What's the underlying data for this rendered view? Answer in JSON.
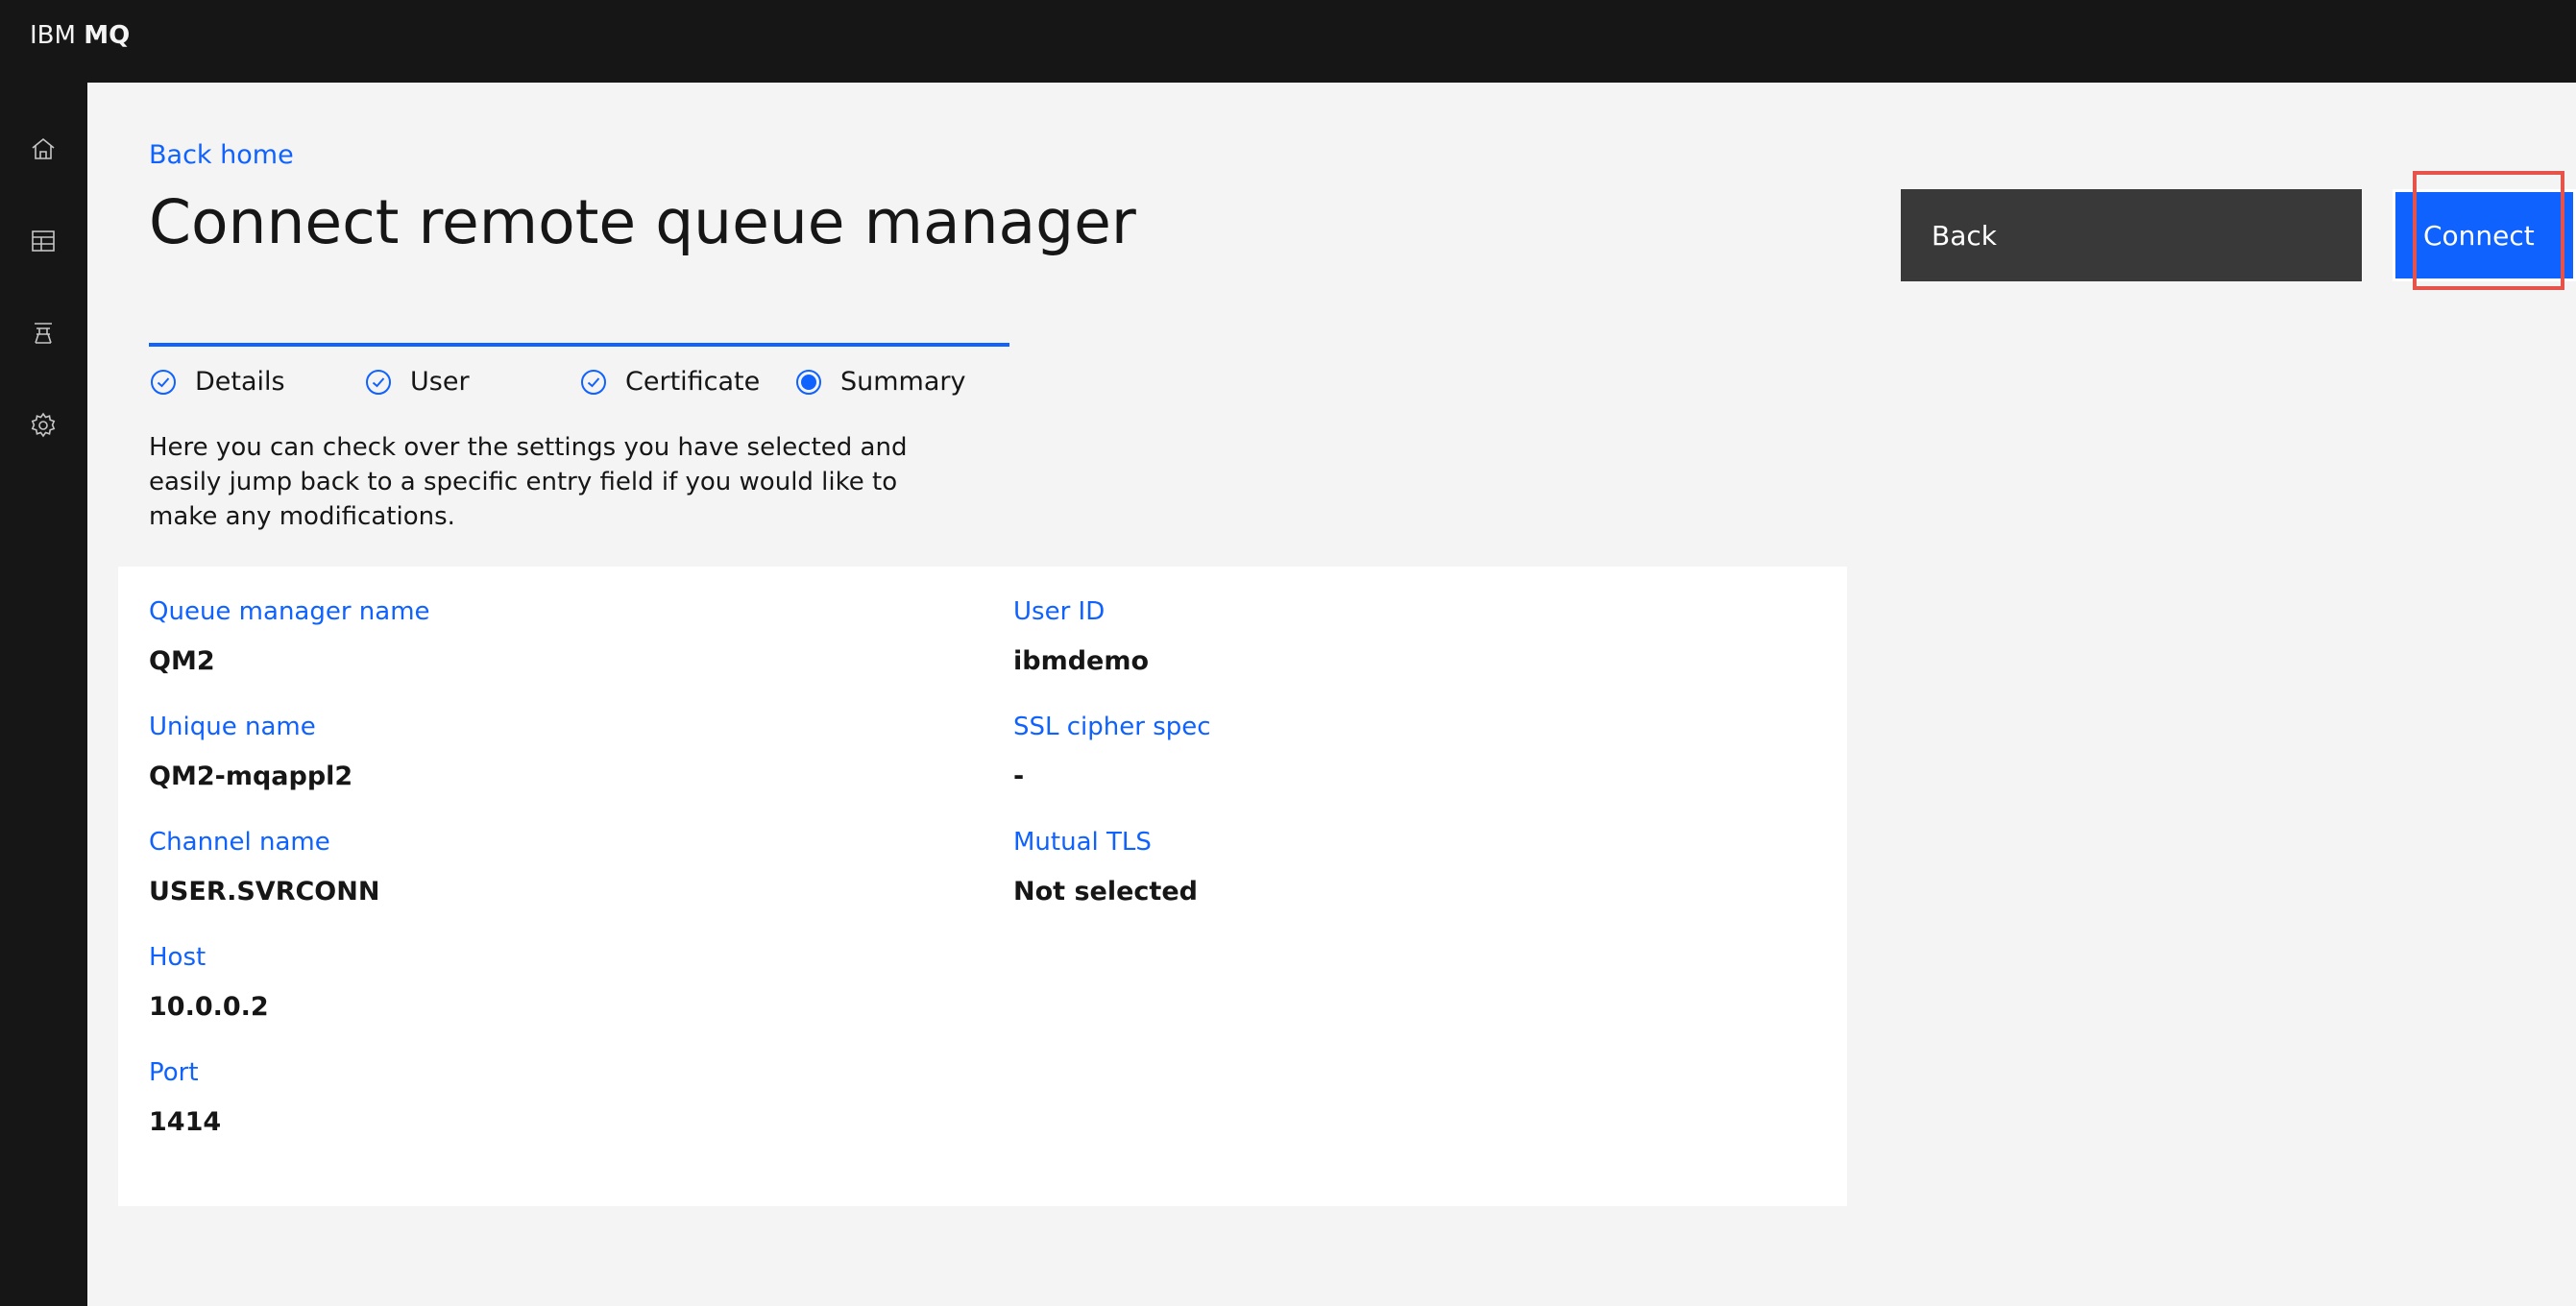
{
  "app": {
    "brand_prefix": "IBM",
    "brand_name": "MQ"
  },
  "sidenav": {
    "items": [
      "home-icon",
      "table-icon",
      "queue-manager-icon",
      "settings-icon"
    ]
  },
  "page": {
    "back_link": "Back home",
    "title": "Connect remote queue manager",
    "description": "Here you can check over the settings you have selected and easily jump back to a specific entry field if you would like to make any modifications."
  },
  "actions": {
    "back_label": "Back",
    "connect_label": "Connect"
  },
  "steps": [
    {
      "label": "Details",
      "state": "complete"
    },
    {
      "label": "User",
      "state": "complete"
    },
    {
      "label": "Certificate",
      "state": "complete"
    },
    {
      "label": "Summary",
      "state": "current"
    }
  ],
  "summary": {
    "left": [
      {
        "label": "Queue manager name",
        "value": "QM2"
      },
      {
        "label": "Unique name",
        "value": "QM2-mqappl2"
      },
      {
        "label": "Channel name",
        "value": "USER.SVRCONN"
      },
      {
        "label": "Host",
        "value": "10.0.0.2"
      },
      {
        "label": "Port",
        "value": "1414"
      }
    ],
    "right": [
      {
        "label": "User ID",
        "value": "ibmdemo"
      },
      {
        "label": "SSL cipher spec",
        "value": "-"
      },
      {
        "label": "Mutual TLS",
        "value": "Not selected"
      }
    ]
  },
  "colors": {
    "accent": "#0f62fe",
    "header_bg": "#161616",
    "highlight": "#e5534b"
  }
}
